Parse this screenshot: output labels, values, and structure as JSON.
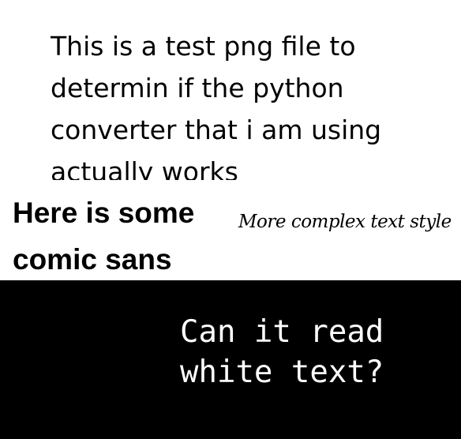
{
  "intro_text": "This is a test png file to determin if the python converter that i am using actually works",
  "comic_text": "Here is some comic sans",
  "fancy_text": "More complex text style",
  "white_text": "Can it read white text?",
  "colors": {
    "background": "#ffffff",
    "text": "#000000",
    "panel": "#000000",
    "panel_text": "#ffffff"
  }
}
